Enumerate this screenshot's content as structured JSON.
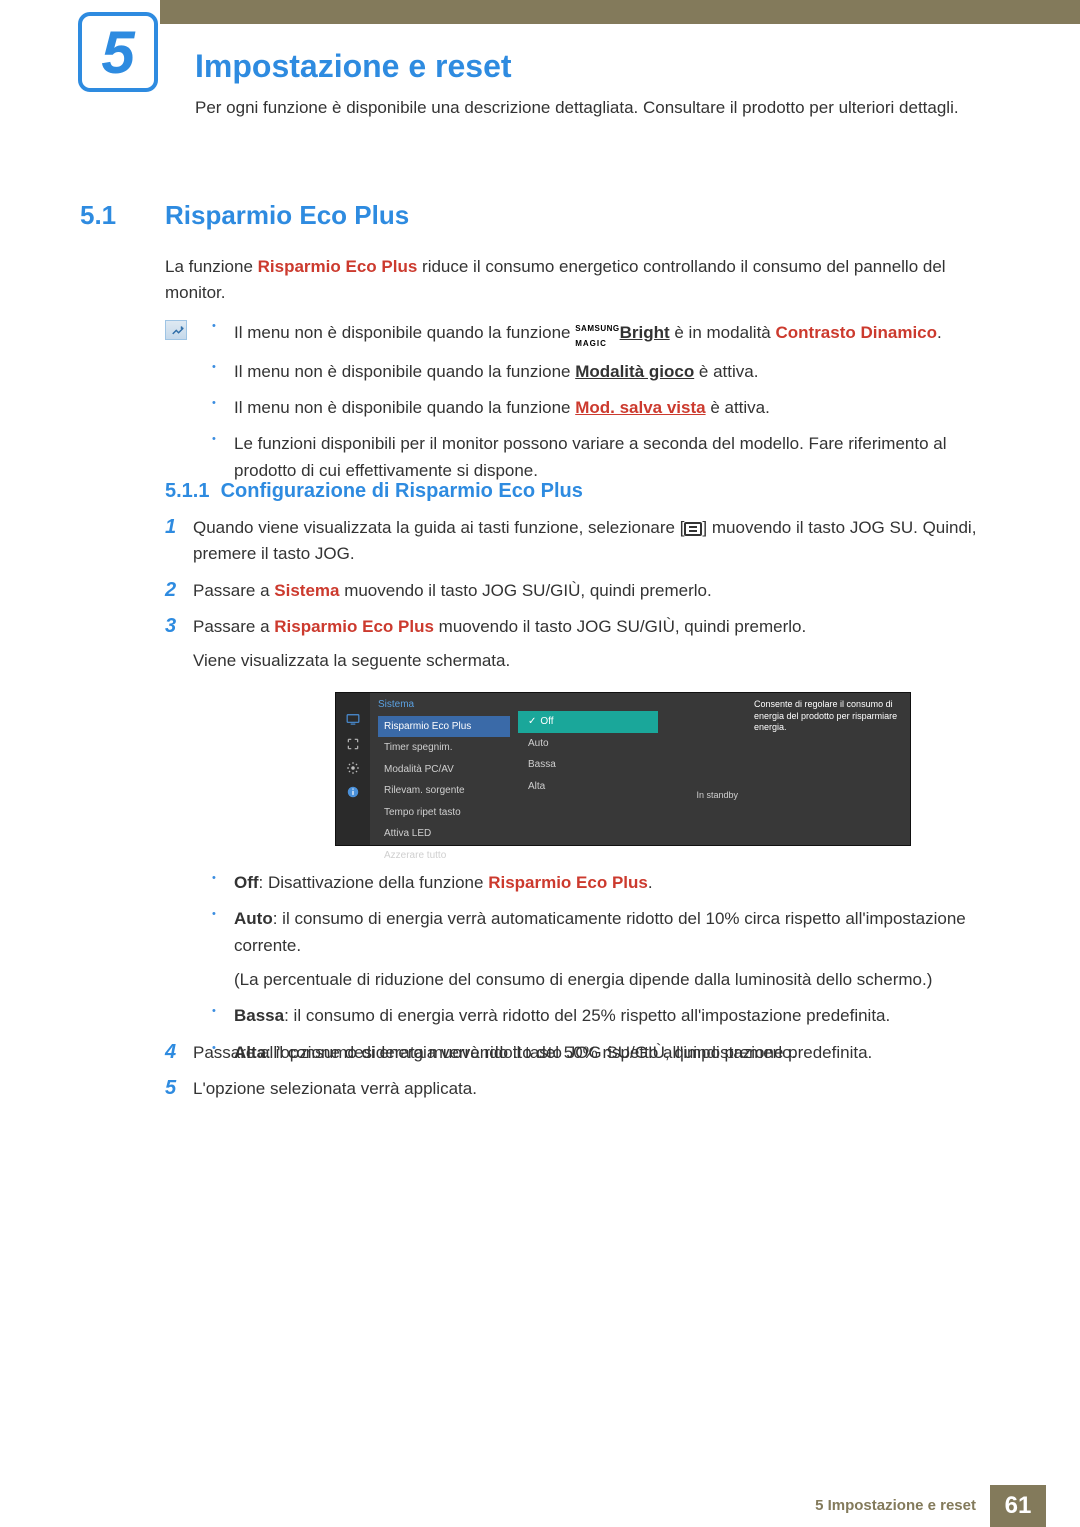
{
  "chapter": {
    "number": "5",
    "title": "Impostazione e reset",
    "intro": "Per ogni funzione è disponibile una descrizione dettagliata. Consultare il prodotto per ulteriori dettagli."
  },
  "section": {
    "number": "5.1",
    "title": "Risparmio Eco Plus"
  },
  "section_intro": {
    "prefix": "La funzione ",
    "highlight": "Risparmio Eco Plus",
    "suffix": " riduce il consumo energetico controllando il consumo del pannello del monitor."
  },
  "notes": {
    "n1": {
      "a": "Il menu non è disponibile quando la funzione ",
      "bright_sup": "SAMSUNG",
      "bright_sub": "MAGIC",
      "bright_main": "Bright",
      "b": " è in modalità ",
      "c": "Contrasto Dinamico",
      "d": "."
    },
    "n2": {
      "a": "Il menu non è disponibile quando la funzione ",
      "b": "Modalità gioco",
      "c": " è attiva."
    },
    "n3": {
      "a": "Il menu non è disponibile quando la funzione ",
      "b": "Mod. salva vista",
      "c": " è attiva."
    },
    "n4": "Le funzioni disponibili per il monitor possono variare a seconda del modello. Fare riferimento al prodotto di cui effettivamente si dispone."
  },
  "subsection": {
    "number": "5.1.1",
    "title": "Configurazione di Risparmio Eco Plus"
  },
  "steps": {
    "s1": {
      "num": "1",
      "a": "Quando viene visualizzata la guida ai tasti funzione, selezionare [",
      "b": "] muovendo il tasto JOG SU. Quindi, premere il tasto JOG."
    },
    "s2": {
      "num": "2",
      "a": "Passare a ",
      "b": "Sistema",
      "c": " muovendo il tasto JOG SU/GIÙ, quindi premerlo."
    },
    "s3": {
      "num": "3",
      "a": "Passare a ",
      "b": "Risparmio Eco Plus",
      "c": " muovendo il tasto JOG SU/GIÙ, quindi premerlo.",
      "d": "Viene visualizzata la seguente schermata."
    },
    "s4": {
      "num": "4",
      "text": "Passare all'opzione desiderata muovendo il tasto JOG SU/GIÙ, quindi premerlo."
    },
    "s5": {
      "num": "5",
      "text": "L'opzione selezionata verrà applicata."
    }
  },
  "osd": {
    "header": "Sistema",
    "menu": [
      "Risparmio Eco Plus",
      "Timer spegnim.",
      "Modalità PC/AV",
      "Rilevam. sorgente",
      "Tempo ripet tasto",
      "Attiva LED",
      "Azzerare tutto"
    ],
    "options": [
      "Off",
      "Auto",
      "Bassa",
      "Alta"
    ],
    "right_value": "In standby",
    "desc": "Consente di regolare il consumo di energia del prodotto per risparmiare energia."
  },
  "option_desc": {
    "off": {
      "label": "Off",
      "a": ": Disattivazione della funzione ",
      "b": "Risparmio Eco Plus",
      "c": "."
    },
    "auto": {
      "label": "Auto",
      "a": ": il consumo di energia verrà automaticamente ridotto del 10% circa rispetto all'impostazione corrente.",
      "note": "(La percentuale di riduzione del consumo di energia dipende dalla luminosità dello schermo.)"
    },
    "bassa": {
      "label": "Bassa",
      "a": ": il consumo di energia verrà ridotto del 25% rispetto all'impostazione predefinita."
    },
    "alta": {
      "label": "Alta",
      "a": ": il consumo di energia verrà ridotto del 50% rispetto all'impostazione predefinita."
    }
  },
  "footer": {
    "caption": "5 Impostazione e reset",
    "page": "61"
  }
}
